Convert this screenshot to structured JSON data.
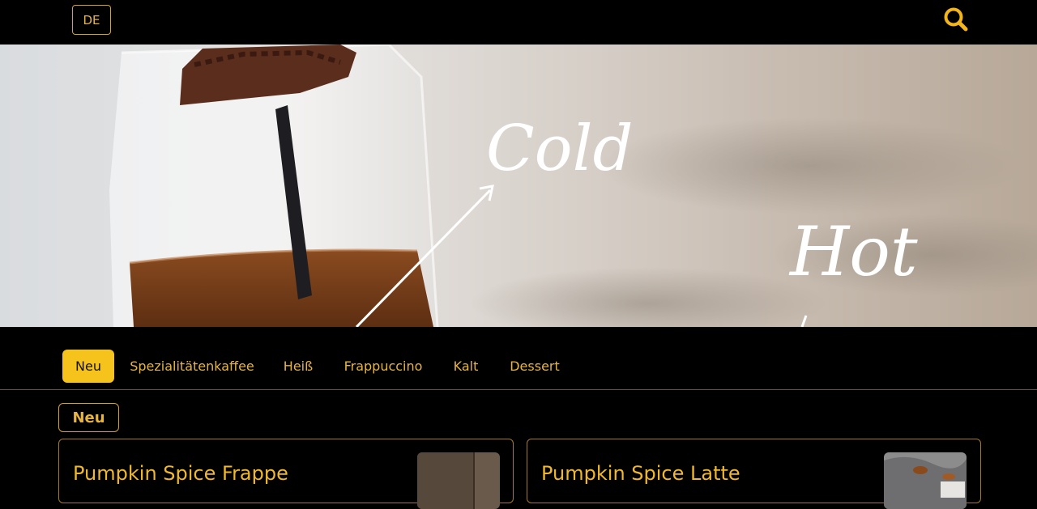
{
  "header": {
    "language_label": "DE",
    "search_icon": "search-icon",
    "accent_color": "#f6c31c"
  },
  "hero": {
    "alt": "Iced coffee bag with straw and chocolate piece",
    "cold_text": "Cold",
    "hot_text": "Hot"
  },
  "categories": {
    "active_index": 0,
    "items": [
      {
        "label": "Neu"
      },
      {
        "label": "Spezialitätenkaffee"
      },
      {
        "label": "Heiß"
      },
      {
        "label": "Frappuccino"
      },
      {
        "label": "Kalt"
      },
      {
        "label": "Dessert"
      }
    ]
  },
  "section": {
    "title": "Neu"
  },
  "products": [
    {
      "name": "Pumpkin Spice Frappe"
    },
    {
      "name": "Pumpkin Spice Latte"
    }
  ]
}
